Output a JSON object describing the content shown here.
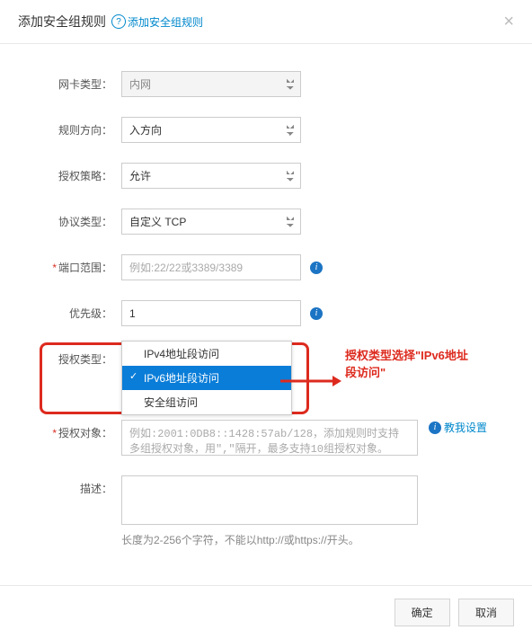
{
  "header": {
    "title": "添加安全组规则",
    "help_link": "添加安全组规则"
  },
  "form": {
    "nic_type": {
      "label": "网卡类型：",
      "value": "内网"
    },
    "direction": {
      "label": "规则方向：",
      "value": "入方向"
    },
    "policy": {
      "label": "授权策略：",
      "value": "允许"
    },
    "protocol": {
      "label": "协议类型：",
      "value": "自定义 TCP"
    },
    "port": {
      "label": "端口范围：",
      "placeholder": "例如:22/22或3389/3389"
    },
    "priority": {
      "label": "优先级：",
      "value": "1"
    },
    "auth_type": {
      "label": "授权类型：",
      "options": [
        "IPv4地址段访问",
        "IPv6地址段访问",
        "安全组访问"
      ],
      "selected_index": 1
    },
    "auth_object": {
      "label": "授权对象：",
      "placeholder": "例如:2001:0DB8::1428:57ab/128，添加规则时支持多组授权对象，用\",\"隔开，最多支持10组授权对象。",
      "help_link": "教我设置"
    },
    "description": {
      "label": "描述：",
      "hint": "长度为2-256个字符，不能以http://或https://开头。"
    }
  },
  "footer": {
    "confirm": "确定",
    "cancel": "取消"
  },
  "annotation": {
    "text": "授权类型选择\"IPv6地址段访问\""
  }
}
